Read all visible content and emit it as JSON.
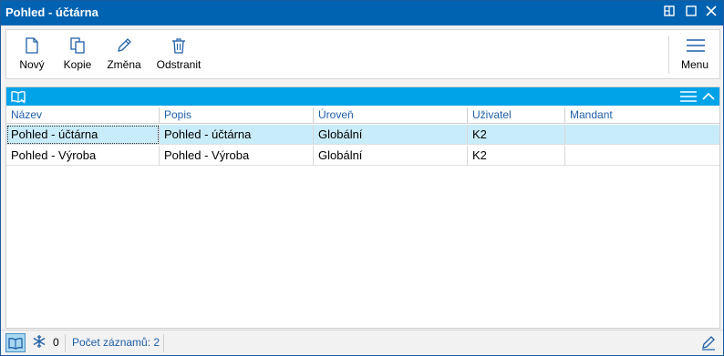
{
  "window": {
    "title": "Pohled - účtárna",
    "controls": [
      "restore-icon",
      "maximize-icon",
      "close-icon"
    ]
  },
  "toolbar": {
    "new_label": "Nový",
    "copy_label": "Kopie",
    "edit_label": "Změna",
    "delete_label": "Odstranit",
    "menu_label": "Menu"
  },
  "grid": {
    "columns": [
      "Název",
      "Popis",
      "Úroveň",
      "Uživatel",
      "Mandant"
    ],
    "rows": [
      {
        "nazev": "Pohled - účtárna",
        "popis": "Pohled - účtárna",
        "uroven": "Globální",
        "uzivatel": "K2",
        "mandant": ""
      },
      {
        "nazev": "Pohled - Výroba",
        "popis": "Pohled - Výroba",
        "uroven": "Globální",
        "uzivatel": "K2",
        "mandant": ""
      }
    ],
    "selected_row": 0
  },
  "status": {
    "freeze_count": "0",
    "record_count": "Počet záznamů: 2"
  },
  "colors": {
    "titlebar": "#0063b1",
    "grid_header": "#00a2e8",
    "selected_row": "#c9ecfa",
    "column_text": "#1f5fa8"
  }
}
